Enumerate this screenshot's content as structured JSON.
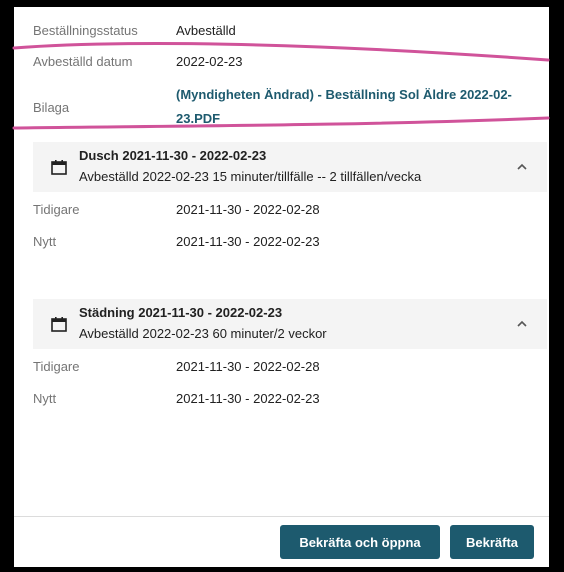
{
  "details": {
    "status_label": "Beställningsstatus",
    "status_value": "Avbeställd",
    "date_label": "Avbeställd datum",
    "date_value": "2022-02-23",
    "attachment_label": "Bilaga",
    "attachment_value": "(Myndigheten Ändrad) - Beställning Sol Äldre 2022-02-23.PDF"
  },
  "sections": [
    {
      "title": "Dusch 2021-11-30 - 2022-02-23",
      "subtitle": "Avbeställd 2022-02-23 15 minuter/tillfälle -- 2 tillfällen/vecka",
      "previous_label": "Tidigare",
      "previous_value": "2021-11-30 - 2022-02-28",
      "new_label": "Nytt",
      "new_value": "2021-11-30 - 2022-02-23"
    },
    {
      "title": "Städning 2021-11-30 - 2022-02-23",
      "subtitle": "Avbeställd 2022-02-23 60 minuter/2 veckor",
      "previous_label": "Tidigare",
      "previous_value": "2021-11-30 - 2022-02-28",
      "new_label": "Nytt",
      "new_value": "2021-11-30 - 2022-02-23"
    }
  ],
  "footer": {
    "confirm_open_label": "Bekräfta och öppna",
    "confirm_label": "Bekräfta"
  },
  "colors": {
    "primary": "#1d5a6e",
    "annotation": "#d0539a"
  },
  "icons": [
    "calendar-icon",
    "chevron-up-icon"
  ]
}
